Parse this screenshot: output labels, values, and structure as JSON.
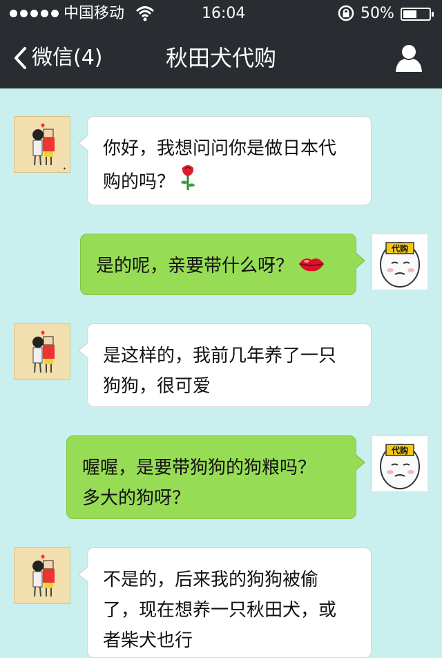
{
  "status_bar": {
    "carrier": "中国移动",
    "time": "16:04",
    "battery": "50%",
    "battery_level": 0.5
  },
  "nav": {
    "back_label": "微信(4)",
    "title": "秋田犬代购",
    "icons": [
      "chevron-left-icon",
      "person-icon"
    ]
  },
  "colors": {
    "bar": "#292c30",
    "chat_background": "#c9f0ee",
    "incoming_bubble": "#ffffff",
    "outgoing_bubble": "#97dc55"
  },
  "messages": [
    {
      "side": "incoming",
      "lines": [
        "你好，我想问问你是做日本代",
        "购的吗？"
      ],
      "emoji": "rose-icon"
    },
    {
      "side": "outgoing",
      "lines": [
        "是的呢，亲要带什么呀？"
      ],
      "emoji": "lips-icon"
    },
    {
      "side": "incoming",
      "lines": [
        "是这样的，我前几年养了一只",
        "狗狗，很可爱"
      ]
    },
    {
      "side": "outgoing",
      "lines": [
        "喔喔，是要带狗狗的狗粮吗？",
        "多大的狗呀？"
      ]
    },
    {
      "side": "incoming",
      "lines": [
        "不是的，后来我的狗狗被偷",
        "了，现在想养一只秋田犬，或",
        "者柴犬也行"
      ]
    }
  ],
  "avatar_badge": "代购"
}
